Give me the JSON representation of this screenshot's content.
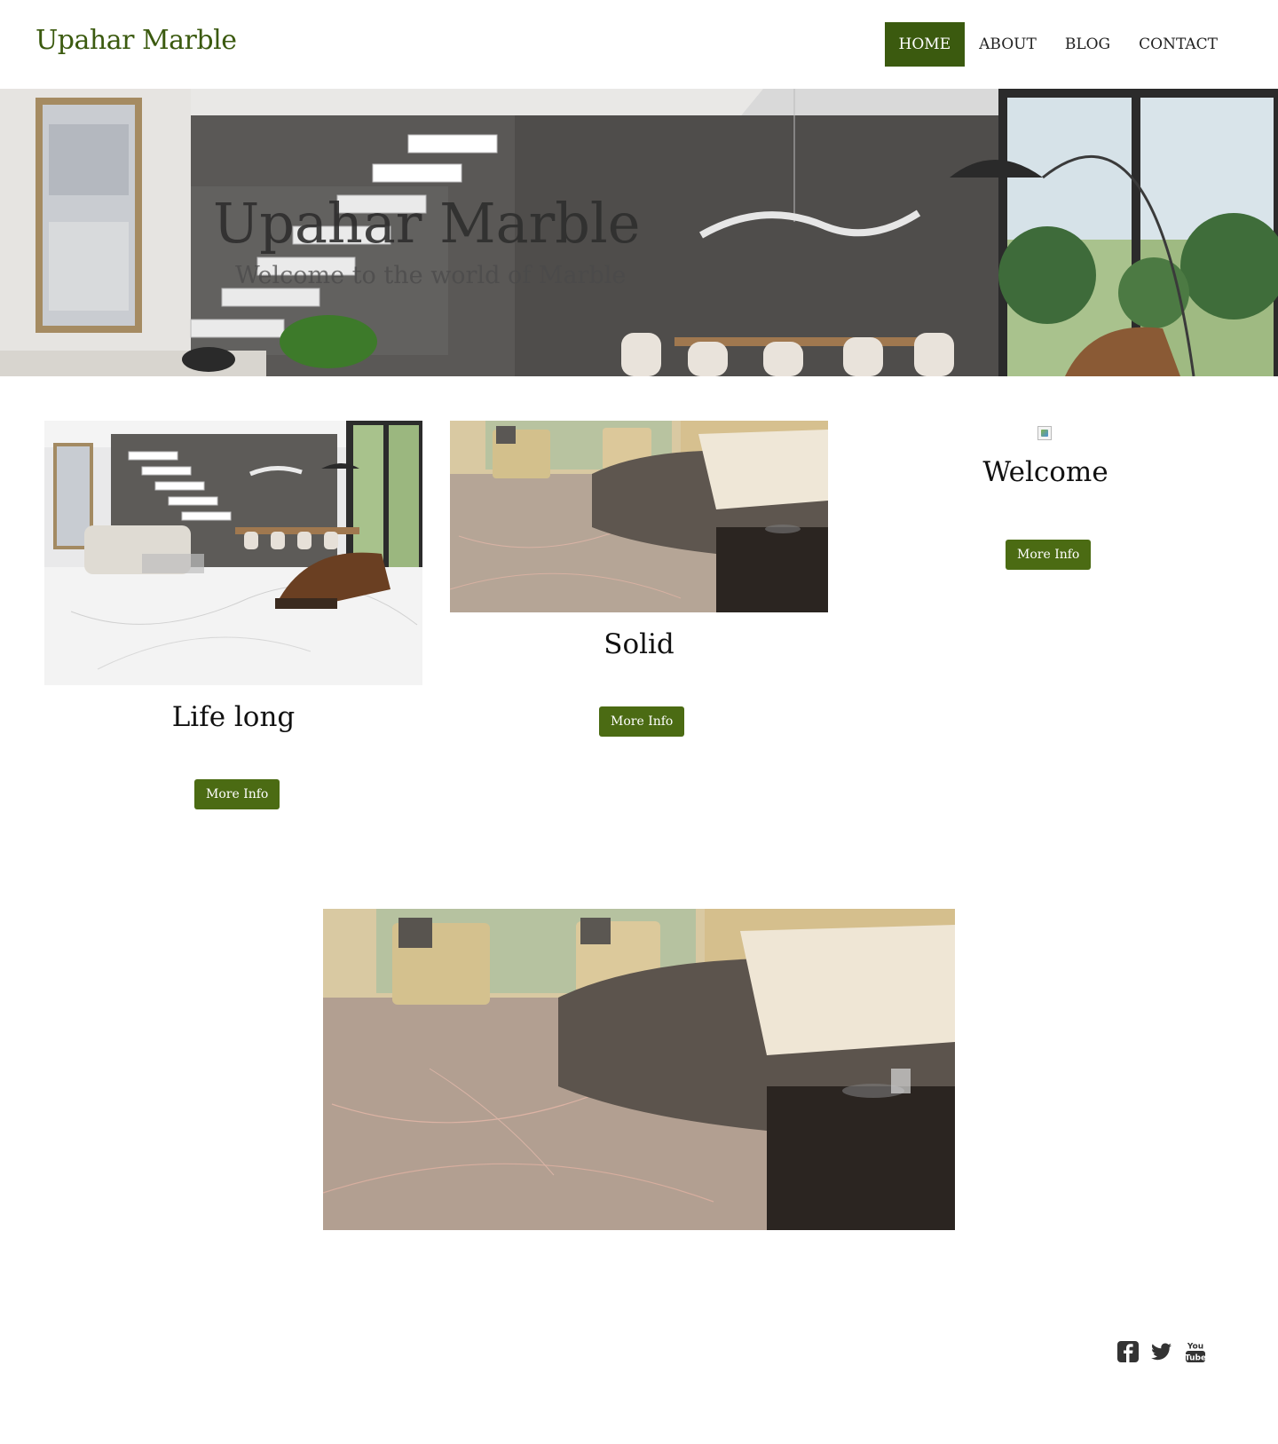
{
  "header": {
    "brand": "Upahar Marble",
    "nav": [
      {
        "label": "HOME",
        "active": true
      },
      {
        "label": "ABOUT",
        "active": false
      },
      {
        "label": "BLOG",
        "active": false
      },
      {
        "label": "CONTACT",
        "active": false
      }
    ]
  },
  "hero": {
    "title": "Upahar Marble",
    "subtitle": "Welcome to the world of Marble"
  },
  "cards": [
    {
      "title": "Life long",
      "button": "More Info"
    },
    {
      "title": "Solid",
      "button": "More Info"
    },
    {
      "title": "Welcome",
      "button": "More Info"
    }
  ],
  "social": {
    "icons": [
      "facebook-icon",
      "twitter-icon",
      "youtube-icon"
    ]
  },
  "colors": {
    "brand_green": "#3b5a0f",
    "button_green": "#4b6b13"
  }
}
